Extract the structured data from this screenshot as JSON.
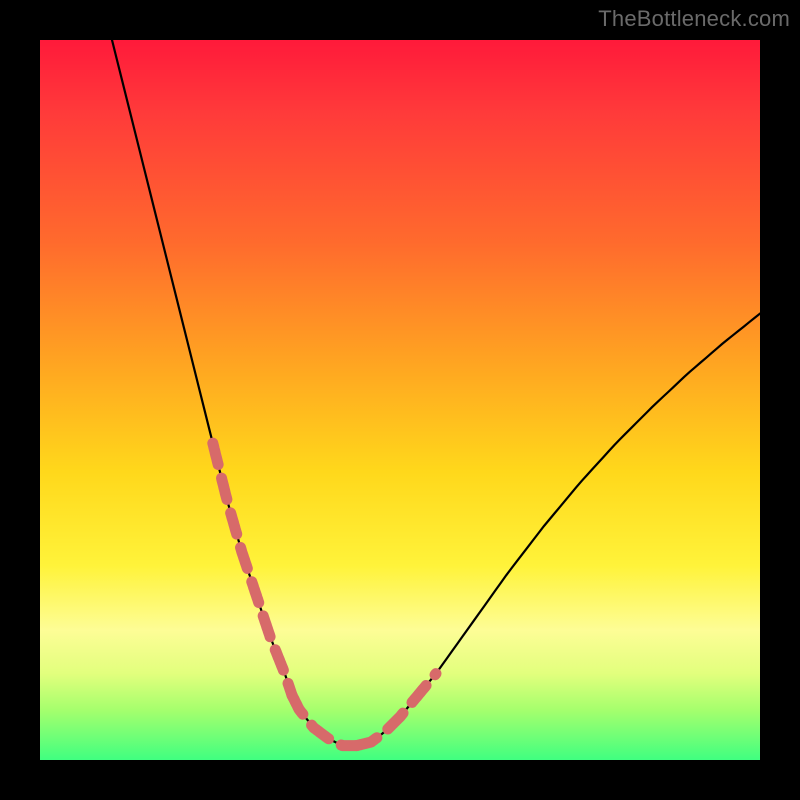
{
  "watermark": "TheBottleneck.com",
  "colors": {
    "background": "#000000",
    "curve_stroke": "#000000",
    "dash_stroke": "#d76a6a",
    "watermark_text": "#6a6a6a",
    "gradient_stops": [
      "#ff1a3a",
      "#ff3a3a",
      "#ff6a2d",
      "#ffa521",
      "#ffd81b",
      "#fff33a",
      "#fdfd96",
      "#e2ff7d",
      "#a6ff6d",
      "#40ff80"
    ]
  },
  "chart_data": {
    "type": "line",
    "title": "",
    "xlabel": "",
    "ylabel": "",
    "xlim": [
      0,
      100
    ],
    "ylim": [
      0,
      100
    ],
    "grid": false,
    "legend": false,
    "x": [
      10,
      12,
      14,
      16,
      18,
      20,
      22,
      24,
      26,
      28,
      30,
      32,
      34,
      35,
      36,
      38,
      40,
      42,
      44,
      46,
      48,
      50,
      55,
      60,
      65,
      70,
      75,
      80,
      85,
      90,
      95,
      100
    ],
    "values": [
      100,
      92,
      84,
      76,
      68,
      60,
      52,
      44,
      36,
      29,
      23,
      17,
      12,
      9,
      7,
      4.5,
      3,
      2,
      2,
      2.5,
      4,
      6,
      12,
      19,
      26,
      32.5,
      38.5,
      44,
      49,
      53.7,
      58,
      62
    ],
    "notes": "Values are vertical position as percent from bottom (0 = bottom green band, 100 = top red). X is percent across plot width. Curve is a V reaching near-zero around x≈40–43, left branch steep, right branch sub-linear.",
    "dash_segments": {
      "description": "Salmon-pink dashed overlay on parts of the curve near the bottom V region.",
      "ranges_x": [
        [
          24,
          35
        ],
        [
          35,
          44
        ],
        [
          44,
          55
        ]
      ]
    }
  }
}
